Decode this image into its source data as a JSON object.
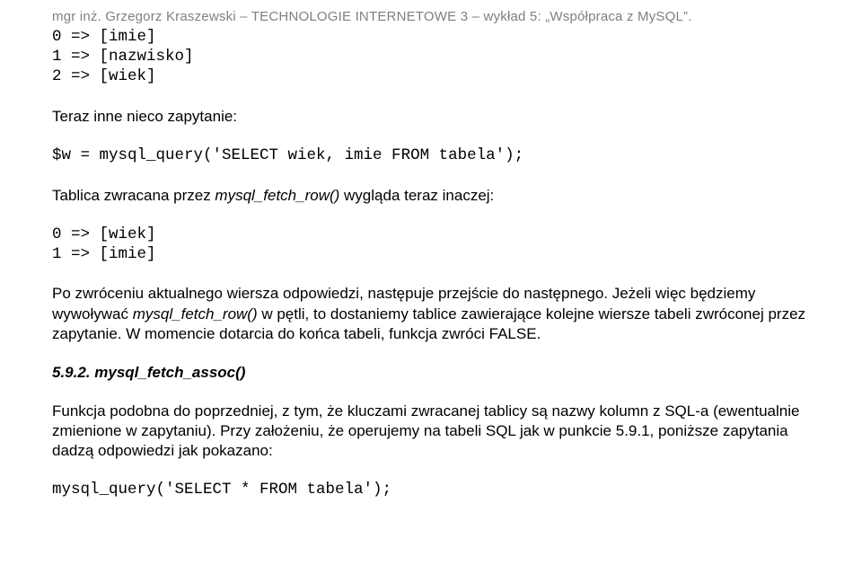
{
  "header": "mgr inż. Grzegorz Kraszewski – TECHNOLOGIE INTERNETOWE 3 – wykład 5: „Współpraca z MySQL”.",
  "code1_line1": "0 => [imie]",
  "code1_line2": "1 => [nazwisko]",
  "code1_line3": "2 => [wiek]",
  "para1": "Teraz inne nieco zapytanie:",
  "code2": "$w = mysql_query('SELECT wiek, imie FROM tabela');",
  "para2_prefix": "Tablica zwracana przez ",
  "para2_italic": "mysql_fetch_row()",
  "para2_suffix": " wygląda teraz inaczej:",
  "code3_line1": "0 => [wiek]",
  "code3_line2": "1 => [imie]",
  "para3_part1": "Po zwróceniu aktualnego wiersza odpowiedzi, następuje przejście do następnego. Jeżeli więc będziemy wywoływać ",
  "para3_italic": "mysql_fetch_row()",
  "para3_part2": " w pętli, to dostaniemy tablice zawierające kolejne wiersze tabeli zwróconej przez zapytanie. W momencie dotarcia do końca tabeli, funkcja zwróci FALSE.",
  "section": "5.9.2. mysql_fetch_assoc()",
  "para4": "Funkcja podobna do poprzedniej, z tym, że kluczami zwracanej tablicy są nazwy kolumn z SQL-a (ewentualnie zmienione w zapytaniu). Przy założeniu, że operujemy na tabeli SQL jak w punkcie 5.9.1, poniższe zapytania dadzą odpowiedzi jak pokazano:",
  "code4": "mysql_query('SELECT * FROM tabela');"
}
